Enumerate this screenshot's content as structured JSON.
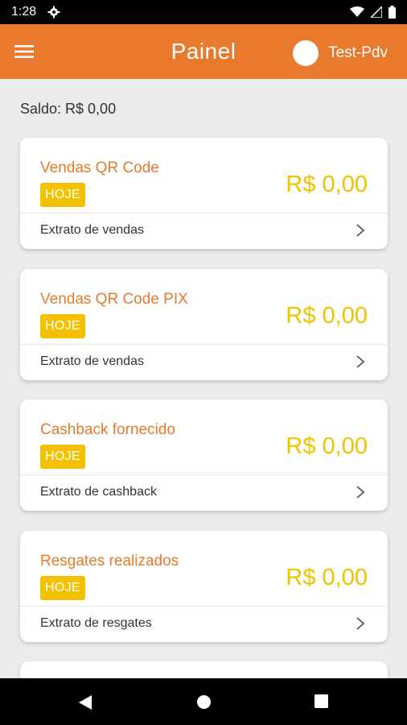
{
  "status_bar": {
    "time": "1:28",
    "icons": [
      "settings-icon",
      "wifi-icon",
      "signal-icon",
      "battery-icon"
    ]
  },
  "app_bar": {
    "title": "Painel",
    "user_name": "Test-Pdv",
    "menu_icon": "hamburger-menu-icon"
  },
  "saldo": "Saldo: R$ 0,00",
  "cards": [
    {
      "title": "Vendas QR Code",
      "badge": "HOJE",
      "amount": "R$ 0,00",
      "link": "Extrato de vendas"
    },
    {
      "title": "Vendas QR Code PIX",
      "badge": "HOJE",
      "amount": "R$ 0,00",
      "link": "Extrato de vendas"
    },
    {
      "title": "Cashback fornecido",
      "badge": "HOJE",
      "amount": "R$ 0,00",
      "link": "Extrato de cashback"
    },
    {
      "title": "Resgates realizados",
      "badge": "HOJE",
      "amount": "R$ 0,00",
      "link": "Extrato de resgates"
    }
  ],
  "colors": {
    "primary": "#e8792d",
    "accent": "#f2c100",
    "background": "#ebebeb"
  },
  "nav_bar": [
    "back-icon",
    "home-icon",
    "recents-icon"
  ]
}
